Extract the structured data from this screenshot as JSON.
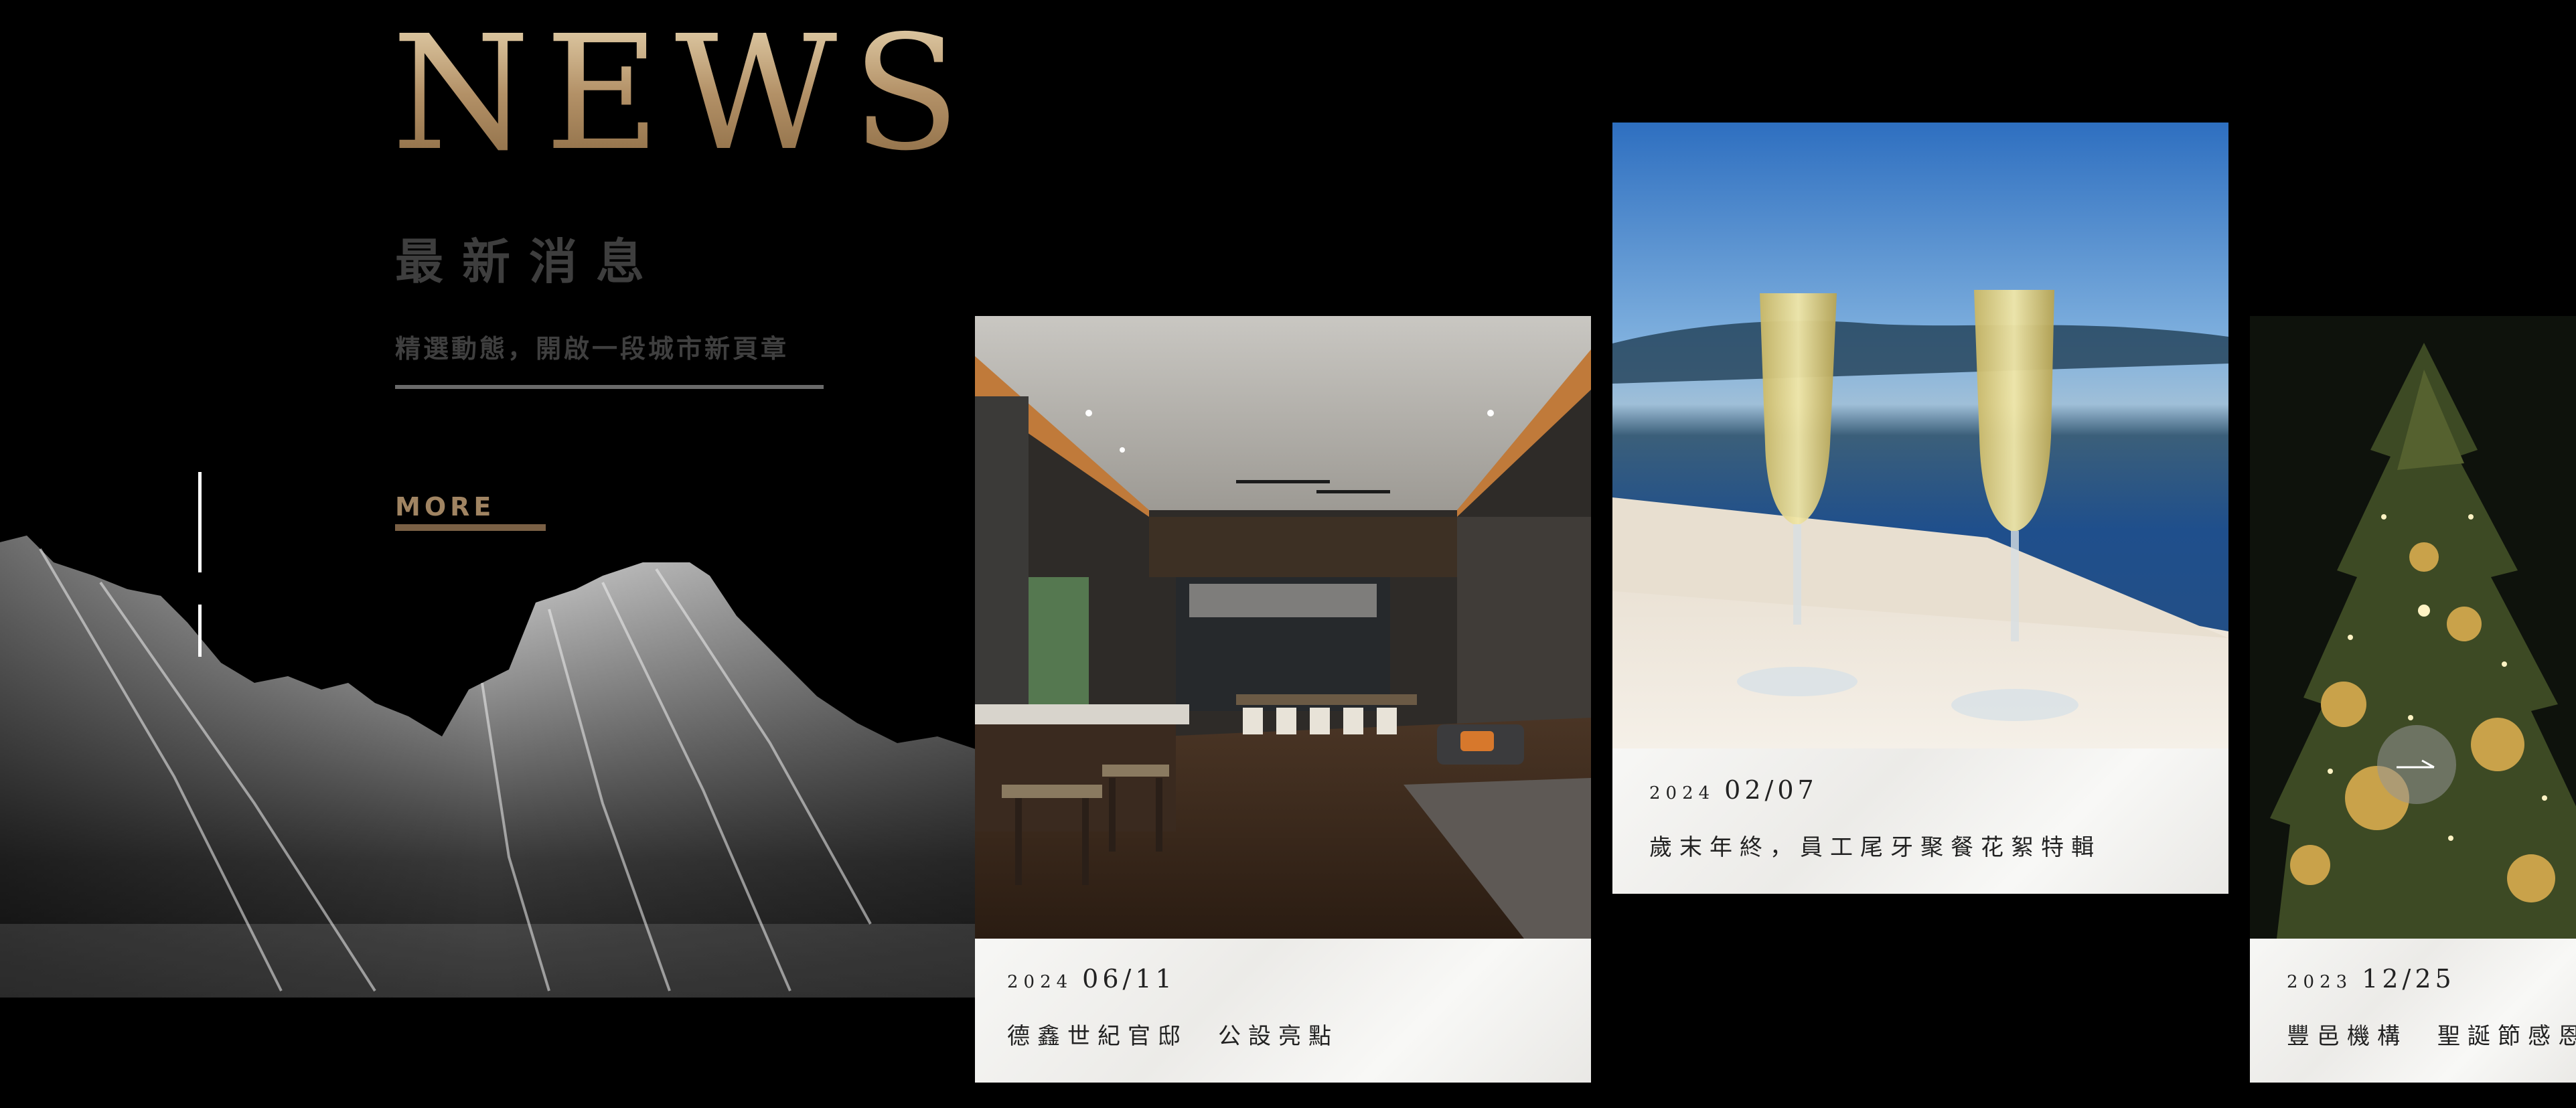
{
  "section": {
    "title": "NEWS",
    "subtitle": "最新消息",
    "description": "精選動態，開啟一段城市新頁章",
    "more_label": "MORE"
  },
  "colors": {
    "background": "#000000",
    "gold": "#b39167",
    "card_caption": "#f4f4f2",
    "text_dark": "#222222"
  },
  "news_cards": [
    {
      "year": "2024",
      "date": "06/11",
      "title": "德鑫世紀官邸　公設亮點",
      "image": "luxury-lounge-interior"
    },
    {
      "year": "2024",
      "date": "02/07",
      "title": "歲末年終，員工尾牙聚餐花絮特輯",
      "image": "champagne-glasses-by-lake"
    },
    {
      "year": "2023",
      "date": "12/25",
      "title": "豐邑機構　聖誕節感恩",
      "image": "christmas-tree"
    }
  ],
  "carousel": {
    "next_icon": "arrow-right-icon"
  }
}
